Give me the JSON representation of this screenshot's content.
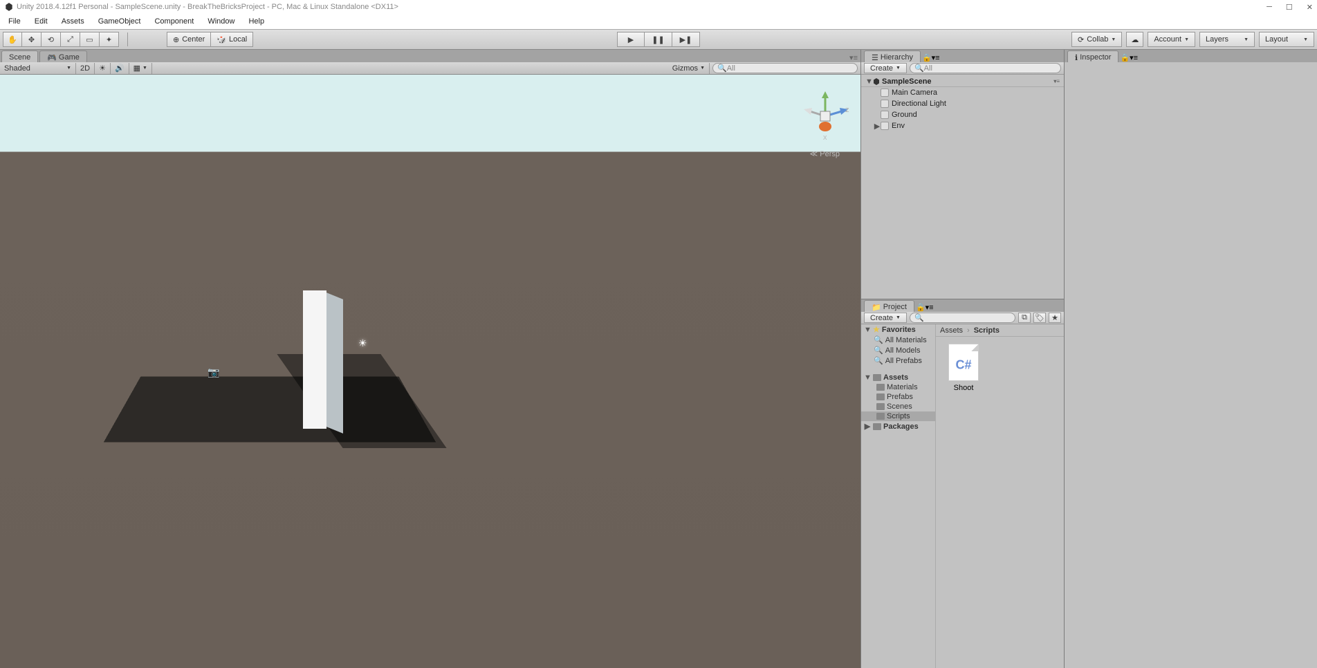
{
  "title": "Unity 2018.4.12f1 Personal - SampleScene.unity - BreakTheBricksProject - PC, Mac & Linux Standalone <DX11>",
  "menu": [
    "File",
    "Edit",
    "Assets",
    "GameObject",
    "Component",
    "Window",
    "Help"
  ],
  "toolbar": {
    "pivot1": "Center",
    "pivot2": "Local",
    "collab": "Collab",
    "account": "Account",
    "layers": "Layers",
    "layout": "Layout"
  },
  "scene": {
    "tab_scene": "Scene",
    "tab_game": "Game",
    "shading": "Shaded",
    "mode2d": "2D",
    "gizmos": "Gizmos",
    "search_placeholder": "All",
    "persp": "Persp"
  },
  "hierarchy": {
    "tab": "Hierarchy",
    "create": "Create",
    "search_placeholder": "All",
    "scene_name": "SampleScene",
    "scene_dirty_suffix": "",
    "items": [
      "Main Camera",
      "Directional Light",
      "Ground",
      "Env"
    ]
  },
  "inspector": {
    "tab": "Inspector"
  },
  "project": {
    "tab": "Project",
    "create": "Create",
    "favorites": {
      "header": "Favorites",
      "items": [
        "All Materials",
        "All Models",
        "All Prefabs"
      ]
    },
    "assets": {
      "header": "Assets",
      "folders": [
        "Materials",
        "Prefabs",
        "Scenes",
        "Scripts"
      ],
      "packages": "Packages"
    },
    "breadcrumb": [
      "Assets",
      "Scripts"
    ],
    "grid": [
      {
        "name": "Shoot"
      }
    ]
  }
}
